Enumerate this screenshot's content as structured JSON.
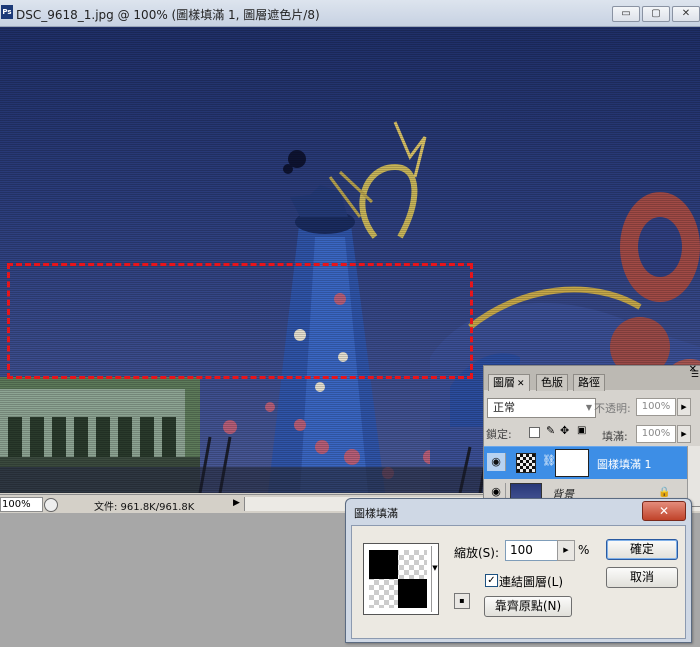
{
  "window": {
    "app_icon": "photoshop-icon",
    "title": "DSC_9618_1.jpg @ 100% (圖樣填滿 1, 圖層遮色片/8)",
    "minimize_glyph": "▭",
    "maximize_glyph": "▢",
    "close_glyph": "✕"
  },
  "status": {
    "zoom": "100%",
    "file_info": "文件: 961.8K/961.8K",
    "arrow": "▶"
  },
  "layers_panel": {
    "tabs": [
      "圖層",
      "色版",
      "路徑"
    ],
    "tab_close": "✕",
    "blend_mode": "正常",
    "opacity_label": "不透明:",
    "opacity": "100%",
    "lock_label": "鎖定:",
    "fill_label": "填滿:",
    "fill": "100%",
    "layers": [
      {
        "name": "圖樣填滿 1",
        "selected": true,
        "icons": [
          "eye-icon",
          "pattern-thumbnail",
          "chain-icon",
          "mask-thumbnail"
        ]
      },
      {
        "name": "背景",
        "selected": false,
        "icons": [
          "eye-icon",
          "image-thumbnail",
          "lock-icon"
        ]
      }
    ]
  },
  "dialog": {
    "title": "圖樣填滿",
    "close_glyph": "✕",
    "scale_label": "縮放(S):",
    "scale_value": "100",
    "scale_unit": "%",
    "link_label": "連結圖層(L)",
    "link_checked": true,
    "ok": "確定",
    "cancel": "取消",
    "snap": "靠齊原點(N)"
  },
  "colors": {
    "selection_marquee": "#e8141a",
    "selected_layer": "#3d8ee6",
    "sky": "#2e407f"
  }
}
